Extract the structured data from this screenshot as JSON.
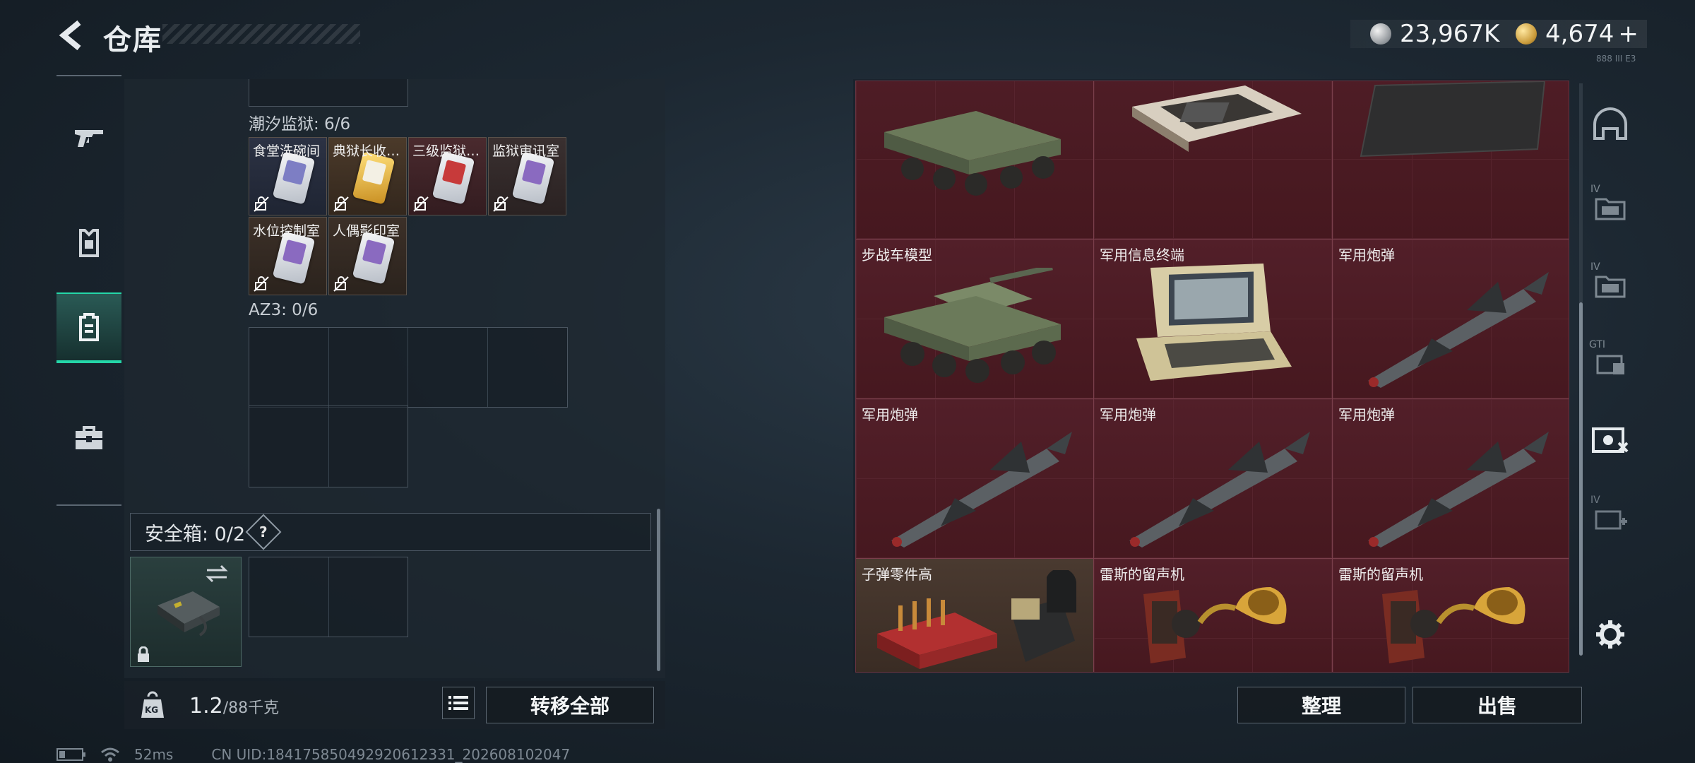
{
  "header": {
    "title": "仓库",
    "silver_amount": "23,967K",
    "gold_amount": "4,674",
    "gold_add": "+",
    "version": "888 III E3"
  },
  "left_nav": [
    "gun-icon",
    "armor-icon",
    "backpack-icon",
    "toolbox-icon"
  ],
  "left_panel": {
    "section1_title": "潮汐监狱: 6/6",
    "section1_items": [
      "食堂洗碗间",
      "典狱长收…",
      "三级监狱…",
      "监狱审讯室",
      "水位控制室",
      "人偶影印室"
    ],
    "section2_title": "AZ3: 0/6",
    "safe_box_title": "安全箱: 0/2",
    "safe_box_help": "?"
  },
  "bottom_left": {
    "weight_value": "1.2",
    "weight_capacity": "/88千克",
    "weight_icon_text": "KG",
    "transfer_all_label": "转移全部"
  },
  "right_panel": {
    "items": [
      {
        "label": ""
      },
      {
        "label": ""
      },
      {
        "label": ""
      },
      {
        "label": "步战车模型"
      },
      {
        "label": "军用信息终端"
      },
      {
        "label": "军用炮弹"
      },
      {
        "label": "军用炮弹"
      },
      {
        "label": "军用炮弹"
      },
      {
        "label": "军用炮弹"
      },
      {
        "label": "子弹零件高"
      },
      {
        "label": "雷斯的留声机"
      },
      {
        "label": "雷斯的留声机"
      }
    ],
    "organize_label": "整理",
    "sell_label": "出售"
  },
  "right_nav": [
    "helmet-icon",
    "folder-iv-icon",
    "folder-iv-icon",
    "gti-card-icon",
    "vision-card-icon",
    "medkit-iv-icon",
    "settings-icon"
  ],
  "right_nav_labels": [
    "IV",
    "IV",
    "GTI",
    "IV"
  ],
  "status_bar": {
    "ping": "52ms",
    "uid": "CN UID:18417585049292061233­1_202608102047"
  }
}
